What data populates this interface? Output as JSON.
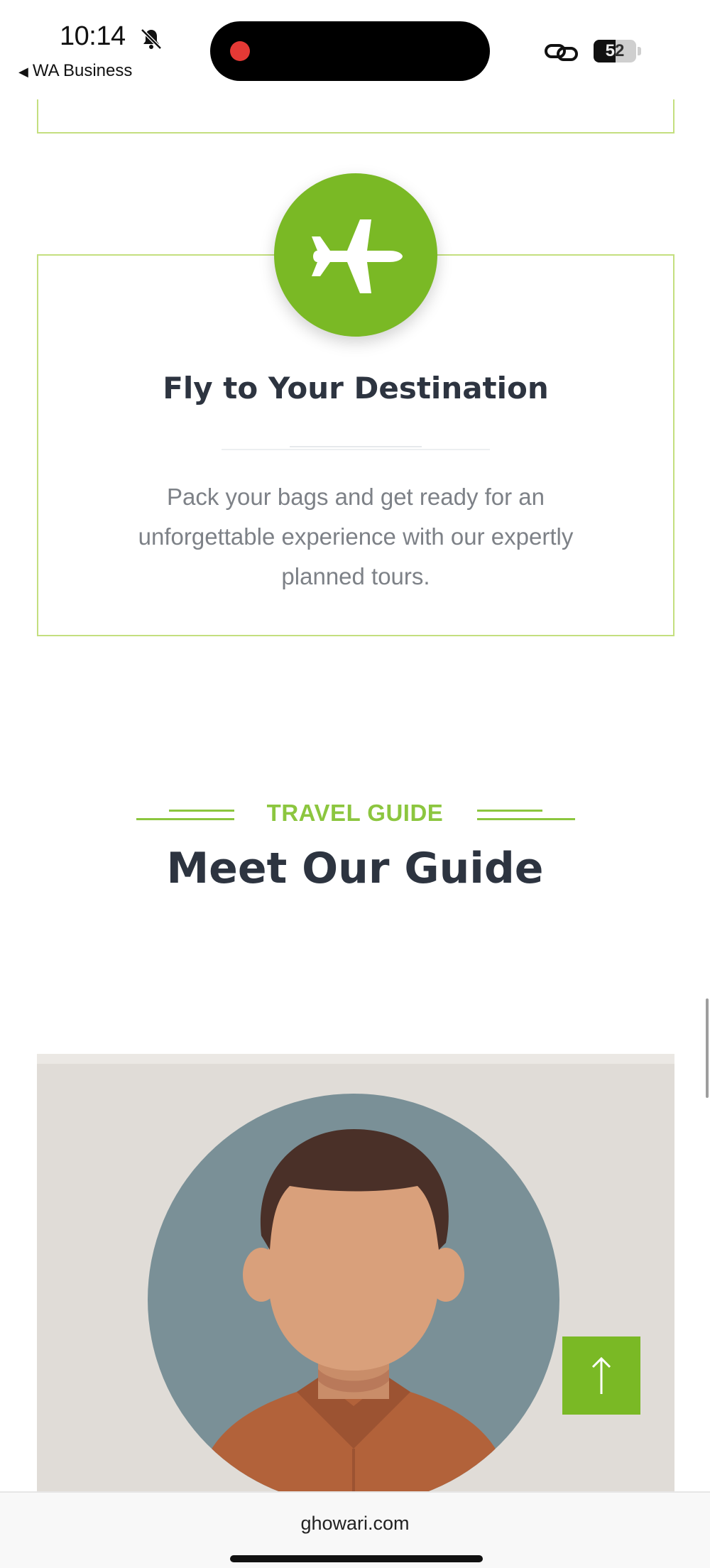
{
  "status_bar": {
    "time": "10:14",
    "back_app": "WA Business",
    "battery": "52",
    "battery_level": 0.52,
    "icons": [
      "bell-muted-icon",
      "recording-dot-icon",
      "link-icon",
      "battery-icon"
    ]
  },
  "step": {
    "icon": "airplane-icon",
    "title": "Fly to Your Destination",
    "description": "Pack your bags and get ready for an unforgettable experience with our expertly planned tours."
  },
  "guide_section": {
    "tag": "TRAVEL GUIDE",
    "title": "Meet Our Guide",
    "avatar": "guide-avatar-illustration"
  },
  "scroll_top": {
    "icon": "arrow-up-icon"
  },
  "url_bar": {
    "domain": "ghowari.com"
  },
  "colors": {
    "accent_green": "#7ab925",
    "tag_green": "#8cc63f",
    "border_green": "#c4df7f",
    "heading": "#2d3440",
    "body_text": "#7d8187",
    "card_bg": "#e0dcd7",
    "avatar_bg": "#7a9097",
    "shirt": "#b2623a",
    "skin": "#d9a07b",
    "hair": "#4a3028"
  }
}
